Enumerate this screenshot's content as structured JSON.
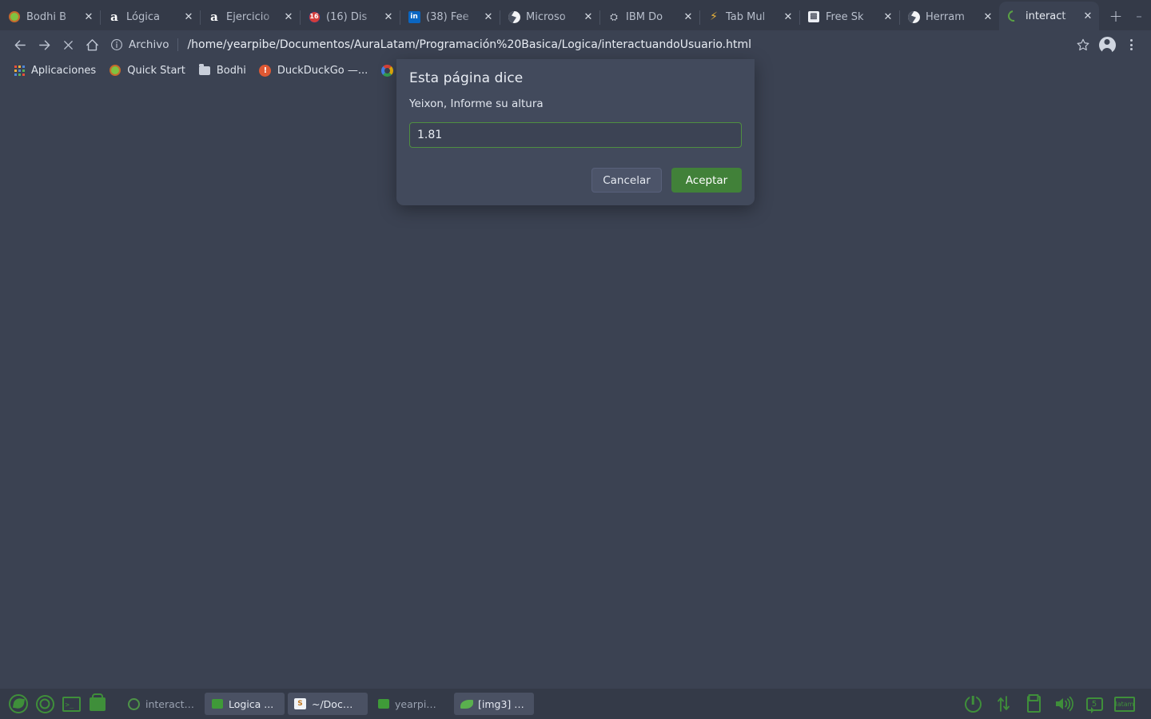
{
  "window": {
    "controls": {
      "minimize": "–",
      "maximize": "⬓",
      "close": "✕"
    }
  },
  "tabs": [
    {
      "title": "Bodhi B",
      "favicon": "bodhi-icon",
      "close": "✕",
      "active": false
    },
    {
      "title": "Lógica ",
      "favicon": "amazon-icon",
      "close": "✕",
      "active": false
    },
    {
      "title": "Ejercicio",
      "favicon": "amazon-icon",
      "close": "✕",
      "active": false
    },
    {
      "title": "(16) Dis",
      "favicon": "disney-icon",
      "close": "✕",
      "active": false
    },
    {
      "title": "(38) Fee",
      "favicon": "linkedin-icon",
      "close": "✕",
      "active": false
    },
    {
      "title": "Microso",
      "favicon": "globe-icon",
      "close": "✕",
      "active": false
    },
    {
      "title": "IBM Do",
      "favicon": "ibm-icon",
      "close": "✕",
      "active": false
    },
    {
      "title": "Tab Mul",
      "favicon": "bolt-icon",
      "close": "✕",
      "active": false
    },
    {
      "title": "Free Sk",
      "favicon": "freeskin-icon",
      "close": "✕",
      "active": false
    },
    {
      "title": "Herram",
      "favicon": "globe-icon",
      "close": "✕",
      "active": false
    },
    {
      "title": "interact",
      "favicon": "loading-spinner-icon",
      "close": "✕",
      "active": true
    }
  ],
  "newtab_label": "+",
  "toolbar": {
    "back": "←",
    "forward": "→",
    "stop": "✕",
    "home": "⌂",
    "scheme_label": "Archivo",
    "url": "/home/yearpibe/Documentos/AuraLatam/Programación%20Basica/Logica/interactuandoUsuario.html",
    "bookmark_star": "☆"
  },
  "bookmarks": [
    {
      "label": "Aplicaciones",
      "icon": "apps-grid-icon"
    },
    {
      "label": "Quick Start",
      "icon": "bodhi-icon"
    },
    {
      "label": "Bodhi",
      "icon": "folder-icon"
    },
    {
      "label": "DuckDuckGo —...",
      "icon": "duckduckgo-icon"
    },
    {
      "label": "",
      "icon": "google-icon"
    }
  ],
  "dialog": {
    "title": "Esta página dice",
    "message": "Yeixon, Informe su altura",
    "input_value": "1.81",
    "input_placeholder": "",
    "cancel_label": "Cancelar",
    "accept_label": "Aceptar",
    "accent_color": "#418139",
    "background_color": "#424a5c"
  },
  "taskbar": {
    "launchers": [
      {
        "name": "bodhi-leaf-icon"
      },
      {
        "name": "chrome-icon"
      },
      {
        "name": "terminal-icon",
        "glyph": ">_"
      },
      {
        "name": "files-icon"
      }
    ],
    "windows": [
      {
        "label": "interact…",
        "icon": "chrome-icon",
        "active": false
      },
      {
        "label": "Logica ...",
        "icon": "files-icon",
        "active": true
      },
      {
        "label": "~/Doc…",
        "icon": "sublime-icon",
        "active": true
      },
      {
        "label": "yearpi…",
        "icon": "files-icon",
        "active": false
      },
      {
        "label": "[img3] …",
        "icon": "leafpad-icon",
        "active": true
      }
    ],
    "tray": [
      {
        "name": "power-icon",
        "label": ""
      },
      {
        "name": "network-icon",
        "label": "↑↓"
      },
      {
        "name": "clipboard-icon",
        "label": ""
      },
      {
        "name": "volume-icon",
        "label": "🔊"
      },
      {
        "name": "workspace-icon",
        "label": "5"
      },
      {
        "name": "keyboard-layout-icon",
        "label": "latam"
      }
    ]
  }
}
